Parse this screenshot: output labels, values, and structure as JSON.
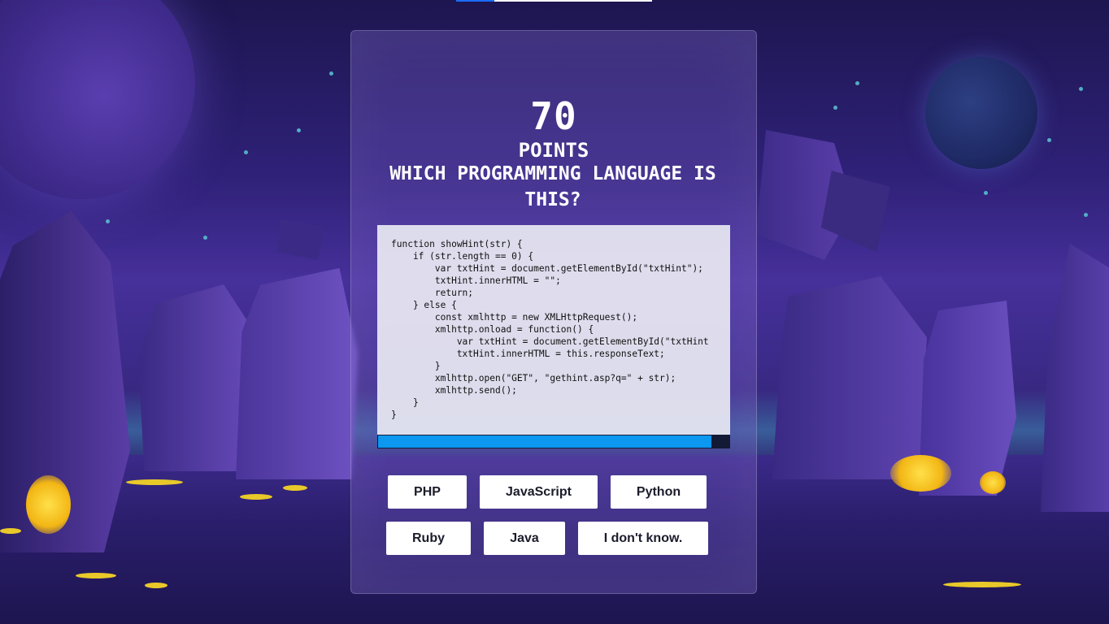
{
  "quiz": {
    "score": "70",
    "score_label": "POINTS",
    "question": "WHICH PROGRAMMING LANGUAGE IS THIS?",
    "code": "function showHint(str) {\n    if (str.length == 0) {\n        var txtHint = document.getElementById(\"txtHint\");\n        txtHint.innerHTML = \"\";\n        return;\n    } else {\n        const xmlhttp = new XMLHttpRequest();\n        xmlhttp.onload = function() {\n            var txtHint = document.getElementById(\"txtHint\n            txtHint.innerHTML = this.responseText;\n        }\n        xmlhttp.open(\"GET\", \"gethint.asp?q=\" + str);\n        xmlhttp.send();\n    }\n}",
    "timer_remaining_fraction": 0.95,
    "answers": [
      "PHP",
      "JavaScript",
      "Python",
      "Ruby",
      "Java",
      "I don't know."
    ]
  },
  "top_progress_fraction": 0.195,
  "colors": {
    "timer_fill": "#0c97f0",
    "timer_track": "#121a35",
    "button_bg": "#ffffff",
    "accent_glow": "#ffe04a"
  }
}
